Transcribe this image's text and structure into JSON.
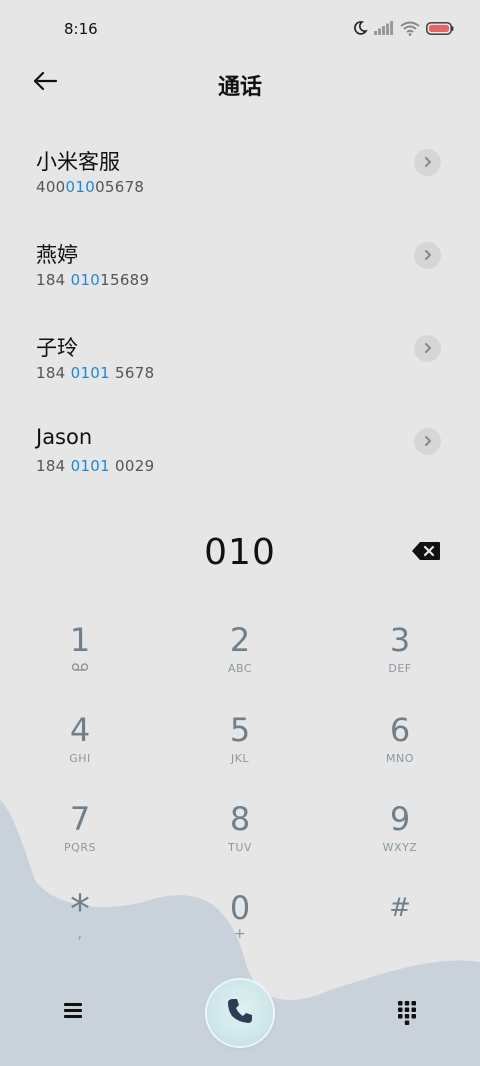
{
  "status_bar": {
    "time": "8:16",
    "icons": [
      "moon-icon",
      "signal-icon",
      "wifi-icon",
      "battery-icon"
    ]
  },
  "header": {
    "title": "通话",
    "back_icon": "arrow-left-icon"
  },
  "contacts": [
    {
      "name": "小米客服",
      "number_before": "400",
      "number_match": "010",
      "number_after": "05678"
    },
    {
      "name": "燕婷",
      "number_before": "184 ",
      "number_match": "010",
      "number_after": "15689"
    },
    {
      "name": "子玲",
      "number_before": "184 ",
      "number_match": "0101",
      "number_after": " 5678"
    },
    {
      "name": "Jason",
      "number_before": "184 ",
      "number_match": "0101",
      "number_after": " 0029"
    }
  ],
  "dialer": {
    "dialed": "010",
    "backspace_icon": "backspace-icon"
  },
  "keypad": [
    {
      "digit": "1",
      "letters": "",
      "sub_icon": "voicemail-icon"
    },
    {
      "digit": "2",
      "letters": "ABC"
    },
    {
      "digit": "3",
      "letters": "DEF"
    },
    {
      "digit": "4",
      "letters": "GHI"
    },
    {
      "digit": "5",
      "letters": "JKL"
    },
    {
      "digit": "6",
      "letters": "MNO"
    },
    {
      "digit": "7",
      "letters": "PQRS"
    },
    {
      "digit": "8",
      "letters": "TUV"
    },
    {
      "digit": "9",
      "letters": "WXYZ"
    },
    {
      "digit": "*",
      "letters": ","
    },
    {
      "digit": "0",
      "letters": "+"
    },
    {
      "digit": "#",
      "letters": ""
    }
  ],
  "bottom_bar": {
    "menu_icon": "hamburger-menu-icon",
    "call_icon": "phone-icon",
    "keypad_icon": "dialpad-icon"
  },
  "colors": {
    "background": "#e6e6e6",
    "wave": "#c8d0da",
    "highlight": "#1e88d6",
    "key_digit": "#6f7f8c"
  }
}
